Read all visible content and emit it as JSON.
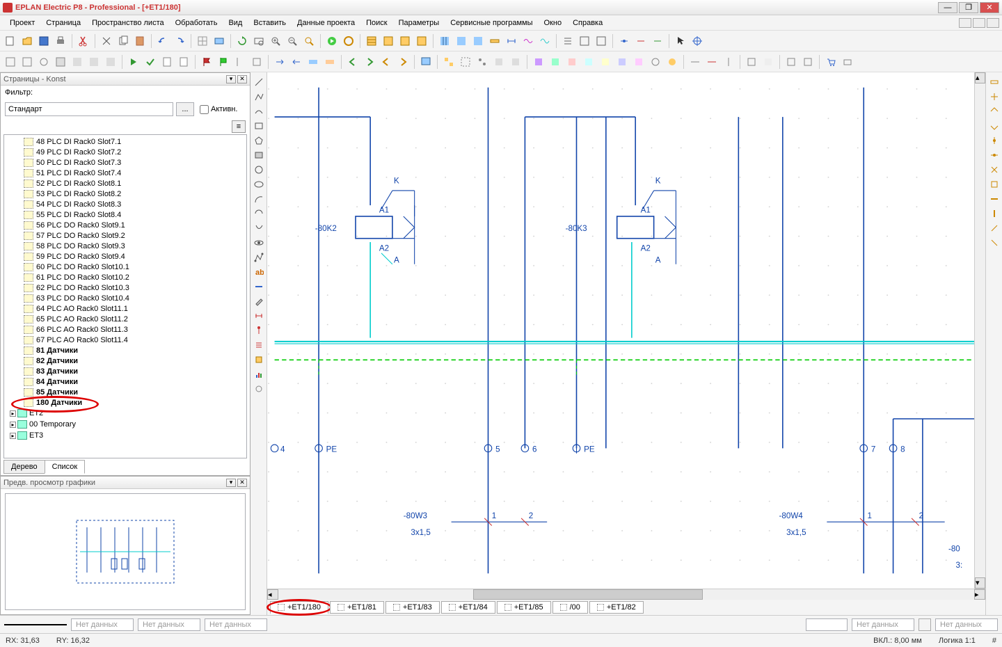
{
  "title": "EPLAN Electric P8 - Professional - [+ET1/180]",
  "menu": [
    "Проект",
    "Страница",
    "Пространство листа",
    "Обработать",
    "Вид",
    "Вставить",
    "Данные проекта",
    "Поиск",
    "Параметры",
    "Сервисные программы",
    "Окно",
    "Справка"
  ],
  "panels": {
    "pages": {
      "title": "Страницы - Konst",
      "filter_label": "Фильтр:",
      "filter_value": "Стандарт",
      "active_label": "Активн."
    },
    "preview": {
      "title": "Предв. просмотр графики"
    }
  },
  "filter_btn": "...",
  "tree_items": [
    {
      "label": "48 PLC DI Rack0 Slot7.1",
      "bold": false
    },
    {
      "label": "49 PLC DI Rack0 Slot7.2",
      "bold": false
    },
    {
      "label": "50 PLC DI Rack0 Slot7.3",
      "bold": false
    },
    {
      "label": "51 PLC DI Rack0 Slot7.4",
      "bold": false
    },
    {
      "label": "52 PLC DI Rack0 Slot8.1",
      "bold": false
    },
    {
      "label": "53 PLC DI Rack0 Slot8.2",
      "bold": false
    },
    {
      "label": "54 PLC DI Rack0 Slot8.3",
      "bold": false
    },
    {
      "label": "55 PLC DI Rack0 Slot8.4",
      "bold": false
    },
    {
      "label": "56 PLC DO Rack0 Slot9.1",
      "bold": false
    },
    {
      "label": "57 PLC DO Rack0 Slot9.2",
      "bold": false
    },
    {
      "label": "58 PLC DO Rack0 Slot9.3",
      "bold": false
    },
    {
      "label": "59 PLC DO Rack0 Slot9.4",
      "bold": false
    },
    {
      "label": "60 PLC DO Rack0 Slot10.1",
      "bold": false
    },
    {
      "label": "61 PLC DO Rack0 Slot10.2",
      "bold": false
    },
    {
      "label": "62 PLC DO Rack0 Slot10.3",
      "bold": false
    },
    {
      "label": "63 PLC DO Rack0 Slot10.4",
      "bold": false
    },
    {
      "label": "64 PLC AO Rack0 Slot11.1",
      "bold": false
    },
    {
      "label": "65 PLC AO Rack0 Slot11.2",
      "bold": false
    },
    {
      "label": "66 PLC AO Rack0 Slot11.3",
      "bold": false
    },
    {
      "label": "67 PLC AO Rack0 Slot11.4",
      "bold": false
    },
    {
      "label": "81 Датчики",
      "bold": true
    },
    {
      "label": "82 Датчики",
      "bold": true
    },
    {
      "label": "83 Датчики",
      "bold": true
    },
    {
      "label": "84 Датчики",
      "bold": true
    },
    {
      "label": "85 Датчики",
      "bold": true
    },
    {
      "label": "180 Датчики",
      "bold": true,
      "highlight": true
    }
  ],
  "tree_nodes": [
    {
      "label": "ET2"
    },
    {
      "label": "00 Temporary",
      "bold": true
    },
    {
      "label": "ET3"
    }
  ],
  "tabs": {
    "tree": "Дерево",
    "list": "Список"
  },
  "page_tabs": [
    {
      "label": "+ET1/180",
      "active": true,
      "highlight": true
    },
    {
      "label": "+ET1/81"
    },
    {
      "label": "+ET1/83"
    },
    {
      "label": "+ET1/84"
    },
    {
      "label": "+ET1/85"
    },
    {
      "label": "/00"
    },
    {
      "label": "+ET1/82"
    }
  ],
  "schematic": {
    "relays": [
      {
        "name": "-80K2",
        "k": "K",
        "a1": "A1",
        "a2": "A2",
        "a": "A"
      },
      {
        "name": "-80K3",
        "k": "K",
        "a1": "A1",
        "a2": "A2",
        "a": "A"
      }
    ],
    "terminals": [
      {
        "label": "4"
      },
      {
        "label": "PE"
      },
      {
        "label": "5"
      },
      {
        "label": "6"
      },
      {
        "label": "PE"
      },
      {
        "label": "7"
      },
      {
        "label": "8"
      }
    ],
    "cables": [
      {
        "name": "-80W3",
        "spec": "3x1,5",
        "c1": "1",
        "c2": "2"
      },
      {
        "name": "-80W4",
        "spec": "3x1,5",
        "c1": "1",
        "c2": "2"
      }
    ],
    "partial": {
      "name": "-80",
      "spec": "3:"
    }
  },
  "bottom_fields": [
    "Нет данных",
    "Нет данных",
    "Нет данных",
    "Нет данных",
    "Нет данных"
  ],
  "status": {
    "rx": "RX: 31,63",
    "ry": "RY: 16,32",
    "vkl": "ВКЛ.: 8,00 мм",
    "logic": "Логика 1:1",
    "hash": "#"
  }
}
